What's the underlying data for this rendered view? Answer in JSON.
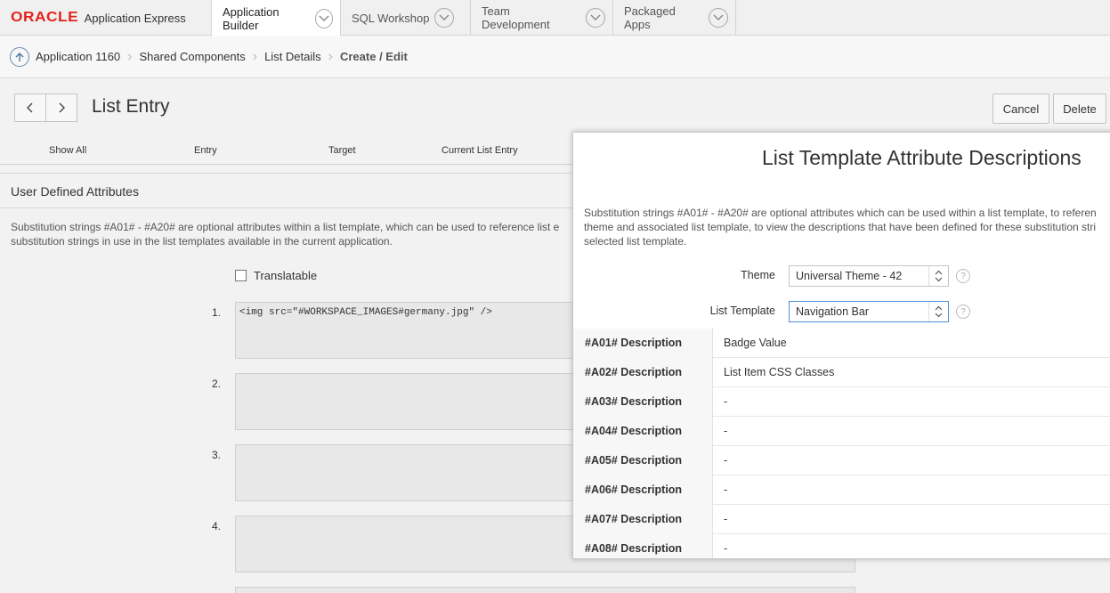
{
  "brand": {
    "oracle": "ORACLE",
    "product": "Application Express"
  },
  "nav_tabs": [
    {
      "label": "Application Builder"
    },
    {
      "label": "SQL Workshop"
    },
    {
      "label": "Team Development"
    },
    {
      "label": "Packaged Apps"
    }
  ],
  "breadcrumb": {
    "items": [
      "Application 1160",
      "Shared Components",
      "List Details"
    ],
    "current": "Create / Edit"
  },
  "page": {
    "title": "List Entry",
    "cancel_label": "Cancel",
    "delete_label": "Delete"
  },
  "tabs": [
    "Show All",
    "Entry",
    "Target",
    "Current List Entry"
  ],
  "region": {
    "title": "User Defined Attributes",
    "desc_line1": "Substitution strings #A01# - #A20# are optional attributes within a list template, which can be used to reference list e",
    "desc_line2": "substitution strings in use in the list templates available in the current application."
  },
  "translatable_label": "Translatable",
  "attributes": [
    {
      "num": "1.",
      "value": "<img src=\"#WORKSPACE_IMAGES#germany.jpg\" />"
    },
    {
      "num": "2.",
      "value": ""
    },
    {
      "num": "3.",
      "value": ""
    },
    {
      "num": "4.",
      "value": ""
    }
  ],
  "dialog": {
    "title": "List Template Attribute Descriptions",
    "desc_line1": "Substitution strings #A01# - #A20# are optional attributes which can be used within a list template, to referen",
    "desc_line2": "theme and associated list template, to view the descriptions that have been defined for these substitution stri",
    "desc_line3": "selected list template.",
    "theme_label": "Theme",
    "theme_value": "Universal Theme - 42",
    "list_template_label": "List Template",
    "list_template_value": "Navigation Bar",
    "rows": [
      {
        "key": "#A01# Description",
        "value": "Badge Value"
      },
      {
        "key": "#A02# Description",
        "value": "List Item CSS Classes"
      },
      {
        "key": "#A03# Description",
        "value": "-"
      },
      {
        "key": "#A04# Description",
        "value": "-"
      },
      {
        "key": "#A05# Description",
        "value": "-"
      },
      {
        "key": "#A06# Description",
        "value": "-"
      },
      {
        "key": "#A07# Description",
        "value": "-"
      },
      {
        "key": "#A08# Description",
        "value": "-"
      }
    ]
  },
  "colors": {
    "brand_red": "#e2231a",
    "focus_blue": "#4f8fd6"
  }
}
